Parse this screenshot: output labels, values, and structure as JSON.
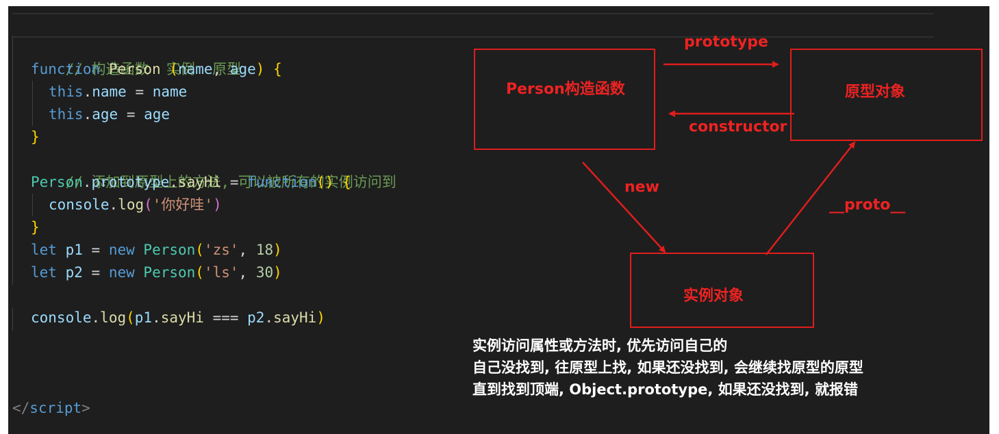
{
  "code": {
    "comment1": "// 构造函数  实例  原型",
    "fn_keyword": "function",
    "fn_name": "Person",
    "param_name": "name",
    "param_age": "age",
    "this1": "this",
    "prop_name": "name",
    "val_name": "name",
    "this2": "this",
    "prop_age": "age",
    "val_age": "age",
    "comment2": "// 添加到原型上的方法, 可以被所有的实例访问到",
    "proto_obj": "Person",
    "proto_prop": "prototype",
    "proto_method": "sayHi",
    "fn_keyword2": "function",
    "console1": "console",
    "log1": "log",
    "str_hello": "'你好哇'",
    "let1": "let",
    "p1": "p1",
    "new1": "new",
    "cls1": "Person",
    "str_zs": "'zs'",
    "num18": "18",
    "let2": "let",
    "p2": "p2",
    "new2": "new",
    "cls2": "Person",
    "str_ls": "'ls'",
    "num30": "30",
    "console2": "console",
    "log2": "log",
    "arg_p1": "p1",
    "arg_sayhi1": "sayHi",
    "arg_p2": "p2",
    "arg_sayhi2": "sayHi",
    "close_tag": "script"
  },
  "diagram": {
    "constructor_box": "Person构造函数",
    "prototype_box": "原型对象",
    "instance_box": "实例对象",
    "label_prototype": "prototype",
    "label_constructor": "constructor",
    "label_new": "new",
    "label_proto": "__proto__"
  },
  "notes": {
    "line1": "实例访问属性或方法时, 优先访问自己的",
    "line2": "自己没找到, 往原型上找, 如果还没找到, 会继续找原型的原型",
    "line3": "直到找到顶端, Object.prototype, 如果还没找到, 就报错"
  },
  "colors": {
    "editor_bg": "#1e1e1e",
    "diagram_red": "#e11d1d",
    "comment": "#6a9955",
    "keyword": "#569cd6"
  }
}
